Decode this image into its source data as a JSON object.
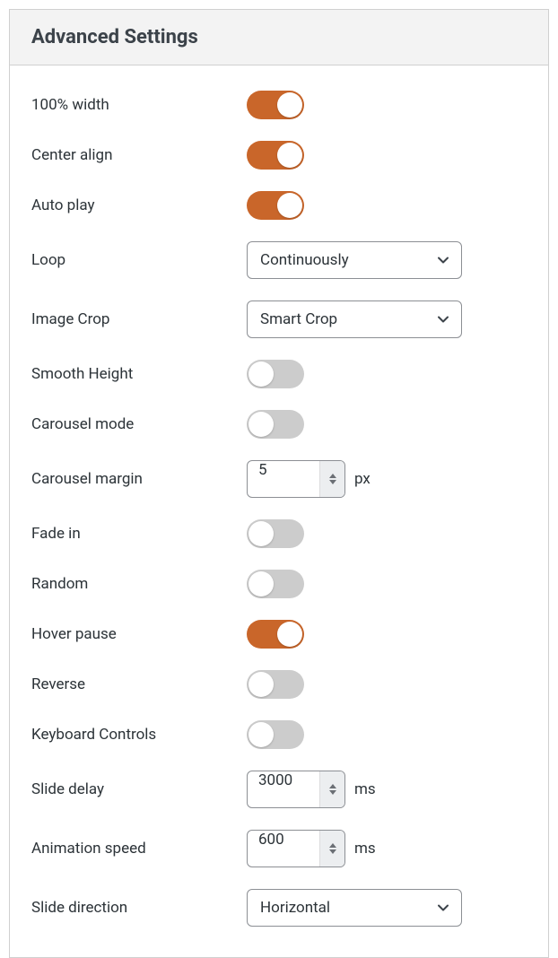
{
  "header": {
    "title": "Advanced Settings"
  },
  "rows": {
    "full_width": {
      "label": "100% width",
      "toggle": true
    },
    "center_align": {
      "label": "Center align",
      "toggle": true
    },
    "auto_play": {
      "label": "Auto play",
      "toggle": true
    },
    "loop": {
      "label": "Loop",
      "select": "Continuously"
    },
    "image_crop": {
      "label": "Image Crop",
      "select": "Smart Crop"
    },
    "smooth_height": {
      "label": "Smooth Height",
      "toggle": false
    },
    "carousel_mode": {
      "label": "Carousel mode",
      "toggle": false
    },
    "carousel_margin": {
      "label": "Carousel margin",
      "number": "5",
      "unit": "px"
    },
    "fade_in": {
      "label": "Fade in",
      "toggle": false
    },
    "random": {
      "label": "Random",
      "toggle": false
    },
    "hover_pause": {
      "label": "Hover pause",
      "toggle": true
    },
    "reverse": {
      "label": "Reverse",
      "toggle": false
    },
    "keyboard_controls": {
      "label": "Keyboard Controls",
      "toggle": false
    },
    "slide_delay": {
      "label": "Slide delay",
      "number": "3000",
      "unit": "ms"
    },
    "animation_speed": {
      "label": "Animation speed",
      "number": "600",
      "unit": "ms"
    },
    "slide_direction": {
      "label": "Slide direction",
      "select": "Horizontal"
    }
  },
  "colors": {
    "accent": "#c9662a"
  }
}
